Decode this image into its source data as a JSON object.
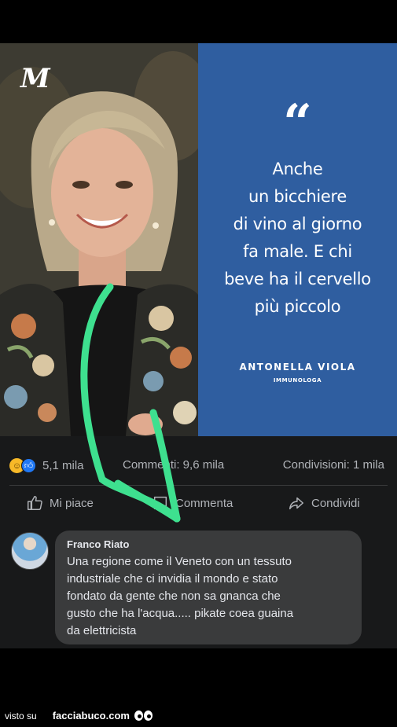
{
  "post": {
    "logo": "M",
    "quote_mark": "“",
    "quote_lines": [
      "Anche",
      "un bicchiere",
      "di vino al giorno",
      "fa male. E chi",
      "beve ha il cervello",
      "più piccolo"
    ],
    "author_name": "ANTONELLA VIOLA",
    "author_role": "IMMUNOLOGA"
  },
  "stats": {
    "reactions_count": "5,1 mila",
    "comments_count": "Commenti: 9,6 mila",
    "shares_count": "Condivisioni: 1 mila"
  },
  "actions": {
    "like_label": "Mi piace",
    "comment_label": "Commenta",
    "share_label": "Condividi"
  },
  "comment": {
    "author": "Franco Riato",
    "text_lines": [
      "Una regione come il Veneto con un tessuto",
      "industriale che ci invidia il mondo e stato",
      "fondato da gente che non sa gnanca che",
      "gusto che ha l'acqua..... pikate coea guaina",
      "da elettricista"
    ]
  },
  "footer": {
    "prefix": "visto su",
    "site": "facciabuco.com"
  },
  "colors": {
    "quote_panel": "#2f5ea0",
    "annotation_arrow": "#3ee08f",
    "facebook_blue": "#2078f4"
  }
}
